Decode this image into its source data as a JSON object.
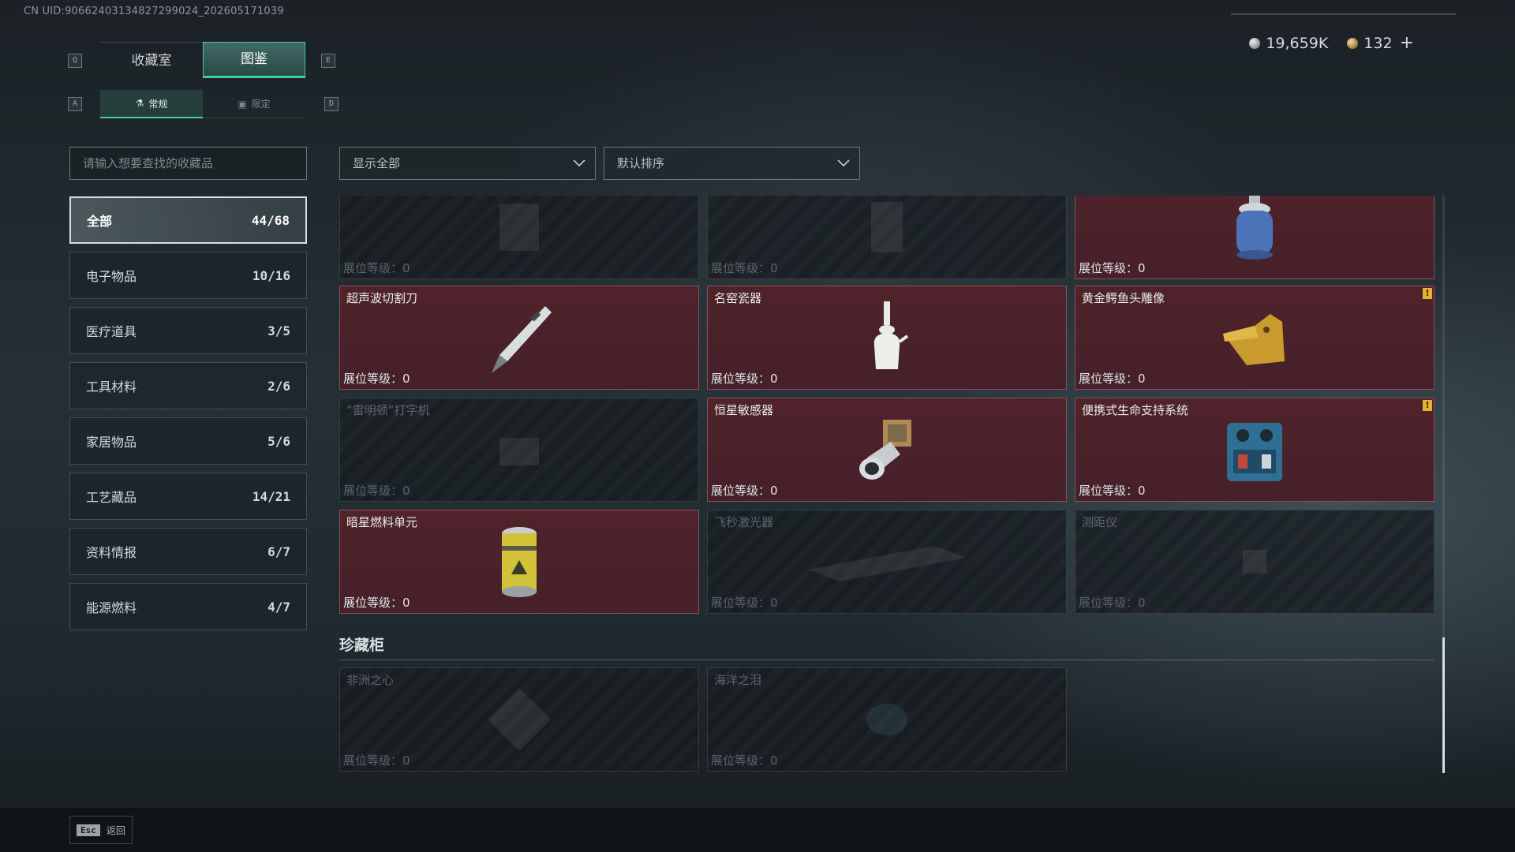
{
  "uid_text": "CN UID:90662403134827299024_202605171039",
  "currency": {
    "silver": "19,659K",
    "gold": "132",
    "add_label": "+"
  },
  "keys": {
    "prev_tab": "Q",
    "next_tab": "E",
    "prev_sub": "A",
    "next_sub": "D"
  },
  "tabs": [
    {
      "label": "收藏室",
      "active": false
    },
    {
      "label": "图鉴",
      "active": true
    }
  ],
  "subtabs": [
    {
      "label": "常规",
      "icon": "flask-icon",
      "active": true
    },
    {
      "label": "限定",
      "icon": "image-icon",
      "active": false
    }
  ],
  "search": {
    "placeholder": "请输入想要查找的收藏品"
  },
  "categories": [
    {
      "label": "全部",
      "count": "44/68",
      "active": true
    },
    {
      "label": "电子物品",
      "count": "10/16"
    },
    {
      "label": "医疗道具",
      "count": "3/5"
    },
    {
      "label": "工具材料",
      "count": "2/6"
    },
    {
      "label": "家居物品",
      "count": "5/6"
    },
    {
      "label": "工艺藏品",
      "count": "14/21"
    },
    {
      "label": "资料情报",
      "count": "6/7"
    },
    {
      "label": "能源燃料",
      "count": "4/7"
    }
  ],
  "filters": {
    "show": "显示全部",
    "sort": "默认排序"
  },
  "level_label": "展位等级：",
  "items": [
    {
      "name": "",
      "level": "0",
      "owned": false,
      "icon": "generic-item-icon"
    },
    {
      "name": "",
      "level": "0",
      "owned": false,
      "icon": "generic-item-icon"
    },
    {
      "name": "",
      "level": "0",
      "owned": true,
      "icon": "gas-canister-icon"
    },
    {
      "name": "超声波切割刀",
      "level": "0",
      "owned": true,
      "icon": "ultrasonic-knife-icon"
    },
    {
      "name": "名窑瓷器",
      "level": "0",
      "owned": true,
      "icon": "porcelain-vase-icon"
    },
    {
      "name": "黄金鳄鱼头雕像",
      "level": "0",
      "owned": true,
      "icon": "gold-crocodile-icon",
      "alert": "!"
    },
    {
      "name": "“雷明顿”打字机",
      "level": "0",
      "owned": false,
      "icon": "typewriter-icon"
    },
    {
      "name": "恒星敏感器",
      "level": "0",
      "owned": true,
      "icon": "star-sensor-icon"
    },
    {
      "name": "便携式生命支持系统",
      "level": "0",
      "owned": true,
      "icon": "life-support-icon",
      "alert": "!"
    },
    {
      "name": "暗星燃料单元",
      "level": "0",
      "owned": true,
      "icon": "fuel-cell-icon"
    },
    {
      "name": "飞秒激光器",
      "level": "0",
      "owned": false,
      "icon": "laser-icon"
    },
    {
      "name": "测距仪",
      "level": "0",
      "owned": false,
      "icon": "rangefinder-icon"
    }
  ],
  "treasure_section": {
    "title": "珍藏柜",
    "items": [
      {
        "name": "非洲之心",
        "level": "0",
        "owned": false,
        "icon": "diamond-icon"
      },
      {
        "name": "海洋之泪",
        "level": "0",
        "owned": false,
        "icon": "gem-icon"
      }
    ]
  },
  "footer": {
    "esc_key": "Esc",
    "back_label": "返回"
  }
}
